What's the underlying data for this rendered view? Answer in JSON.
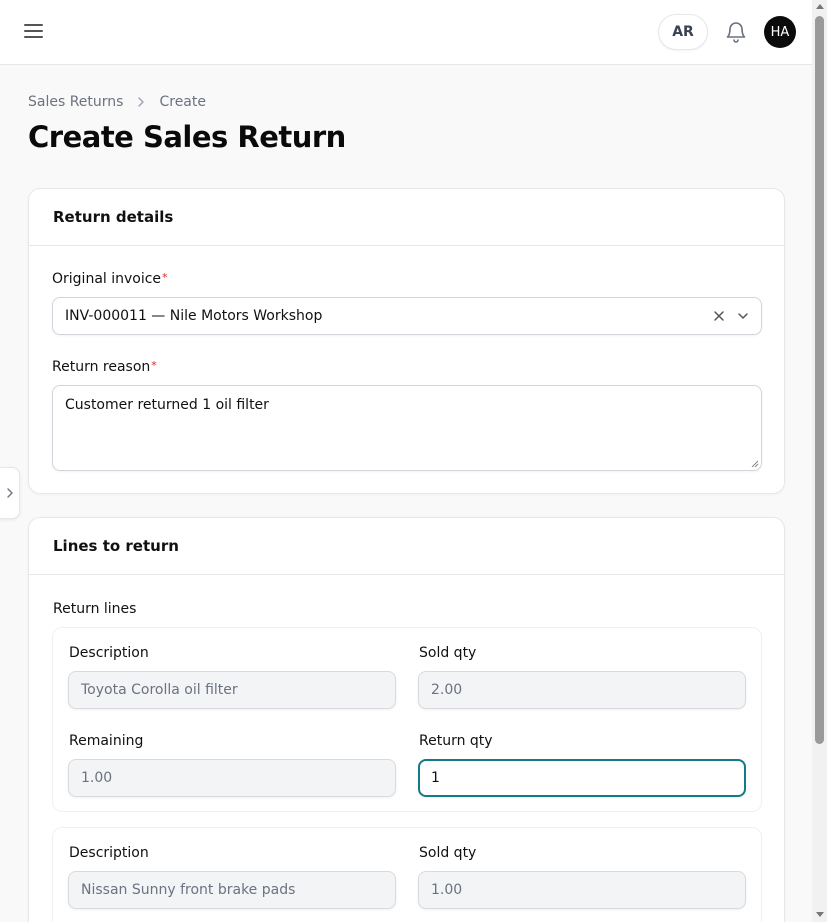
{
  "header": {
    "lang_label": "AR",
    "avatar_initials": "HA"
  },
  "breadcrumb": {
    "parent": "Sales Returns",
    "current": "Create"
  },
  "page_title": "Create Sales Return",
  "return_details": {
    "title": "Return details",
    "invoice_label": "Original invoice",
    "invoice_value": "INV-000011 — Nile Motors Workshop",
    "reason_label": "Return reason",
    "reason_value": "Customer returned 1 oil filter",
    "required_mark": "*"
  },
  "lines": {
    "title": "Lines to return",
    "subsection": "Return lines",
    "labels": {
      "description": "Description",
      "sold_qty": "Sold qty",
      "remaining": "Remaining",
      "return_qty": "Return qty"
    },
    "items": [
      {
        "description": "Toyota Corolla oil filter",
        "sold_qty": "2.00",
        "remaining": "1.00",
        "return_qty": "1"
      },
      {
        "description": "Nissan Sunny front brake pads",
        "sold_qty": "1.00"
      }
    ]
  },
  "colors": {
    "accent": "#157a87",
    "required": "#dc2626",
    "avatar_bg": "#0b0b0b"
  },
  "icons": [
    "menu-icon",
    "bell-icon",
    "chevron-right-icon",
    "clear-icon",
    "chevron-down-icon",
    "resize-handle-icon"
  ]
}
